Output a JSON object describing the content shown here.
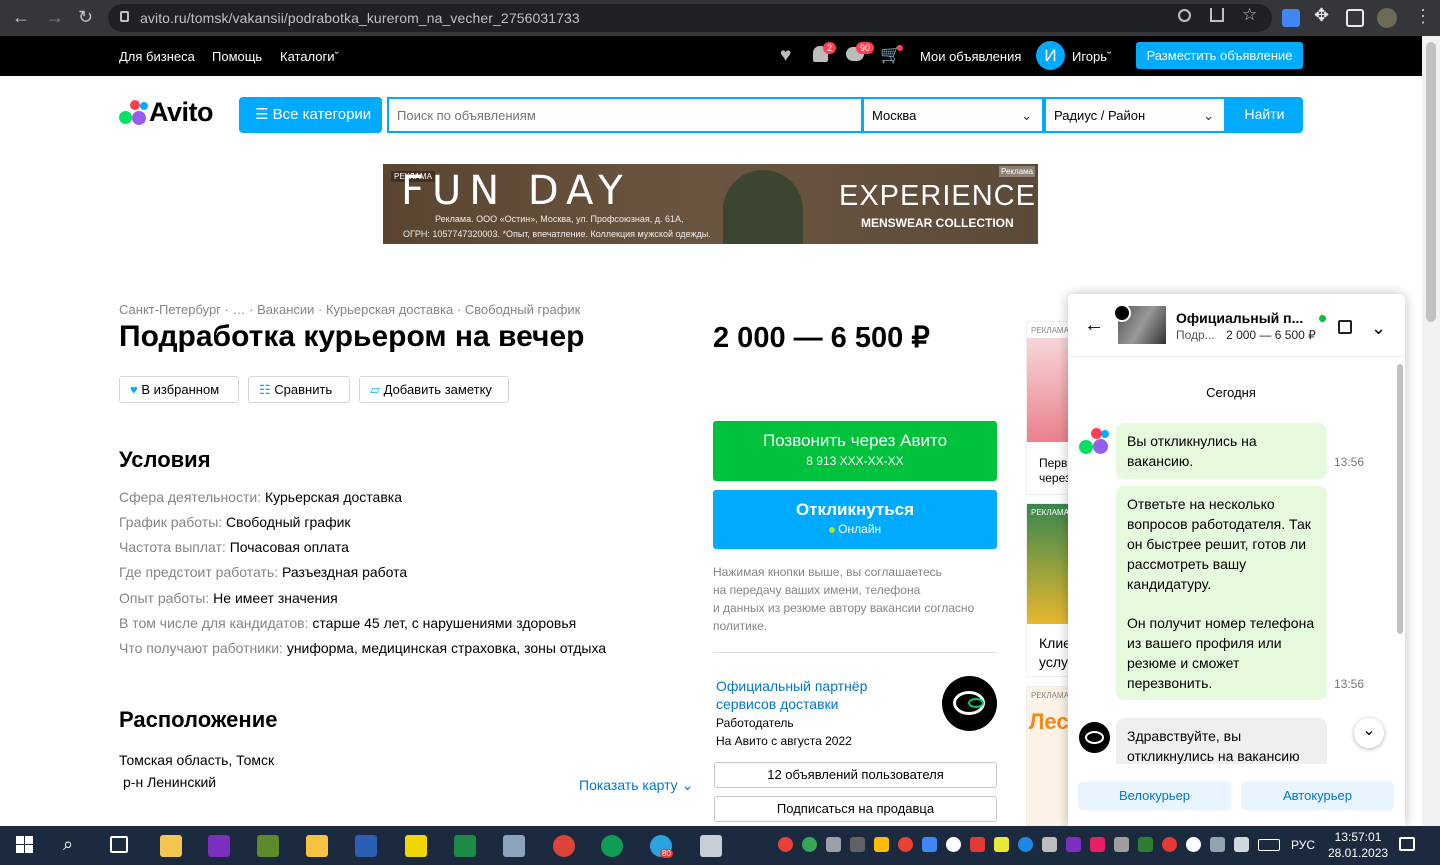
{
  "browser": {
    "url": "avito.ru/tomsk/vakansii/podrabotka_kurerom_na_vecher_2756031733",
    "back": "←",
    "forward": "→",
    "reload": "↻",
    "menu": "⋮"
  },
  "topbar": {
    "business": "Для бизнеса",
    "help": "Помощь",
    "catalogs": "Каталоги",
    "notif_count": "2",
    "msg_count": "90",
    "my_ads": "Мои объявления",
    "avatar_letter": "И",
    "user_name": "Игорь",
    "post_ad": "Разместить объявление"
  },
  "header": {
    "logo": "Avito",
    "all_categories": "Все категории",
    "search_placeholder": "Поиск по объявлениям",
    "city": "Москва",
    "radius": "Радиус / Район",
    "find": "Найти"
  },
  "banner": {
    "tag": "РЕКЛАМА",
    "brand": "FUN DAY",
    "legal1": "Реклама. ООО «Остин», Москва, ул. Профсоюзная, д. 61А,",
    "legal2": "ОГРН: 1057747320003. *Опыт, впечатление. Коллекция мужской одежды.",
    "experience": "EXPERIENCE",
    "collection": "MENSWEAR COLLECTION",
    "ad_label": "Реклама"
  },
  "breadcrumb": [
    "Санкт-Петербург",
    "…",
    "Вакансии",
    "Курьерская доставка",
    "Свободный график"
  ],
  "listing": {
    "title": "Подработка курьером на вечер",
    "price": "2 000 — 6 500 ₽",
    "favorite": "В избранном",
    "compare": "Сравнить",
    "add_note": "Добавить заметку"
  },
  "conditions": {
    "heading": "Условия",
    "rows": [
      {
        "label": "Сфера деятельности:",
        "value": "Курьерская доставка"
      },
      {
        "label": "График работы:",
        "value": "Свободный график"
      },
      {
        "label": "Частота выплат:",
        "value": "Почасовая оплата"
      },
      {
        "label": "Где предстоит работать:",
        "value": "Разъездная работа"
      },
      {
        "label": "Опыт работы:",
        "value": "Не имеет значения"
      },
      {
        "label": "В том числе для кандидатов:",
        "value": "старше 45 лет, с нарушениями здоровья"
      },
      {
        "label": "Что получают работники:",
        "value": "униформа, медицинская страховка, зоны отдыха"
      }
    ]
  },
  "location": {
    "heading": "Расположение",
    "address": "Томская область, Томск",
    "district": "р-н Ленинский",
    "show_map": "Показать карту"
  },
  "actions": {
    "call": "Позвонить через Авито",
    "phone": "8 913 XXX-XX-XX",
    "reply": "Откликнуться",
    "online": "Онлайн",
    "disclaimer": [
      "Нажимая кнопки выше, вы соглашаетесь",
      "на передачу ваших имени, телефона",
      "и данных из резюме автору вакансии согласно",
      "политике."
    ]
  },
  "seller": {
    "name_line1": "Официальный партнёр",
    "name_line2": "сервисов доставки",
    "role": "Работодатель",
    "since": "На Авито с августа 2022",
    "ads_count": "12 объявлений пользователя",
    "subscribe": "Подписаться на продавца"
  },
  "side_ads": {
    "label": "РЕКЛАМА",
    "ad1_text": "Перв через",
    "ad2_text": "Клие услу",
    "ad3_text": "Лес"
  },
  "chat": {
    "title": "Официальный п...",
    "subtitle": "Подр...",
    "price": "2 000 — 6 500 ₽",
    "date": "Сегодня",
    "msg1": "Вы откликнулись на вакансию.",
    "msg1_time": "13:56",
    "msg2_p1": "Ответьте на несколько вопросов работодателя. Так он быстрее решит, готов ли рассмотреть вашу кандидатуру.",
    "msg2_p2": "Он получит номер телефона из вашего профиля или резюме и сможет перезвонить.",
    "msg2_time": "13:56",
    "msg3": "Здравствуйте, вы откликнулись на вакансию",
    "chip1": "Велокурьер",
    "chip2": "Автокурьер"
  },
  "taskbar": {
    "lang": "РУС",
    "time": "13:57:01",
    "date": "28.01.2023",
    "telegram_badge": "80"
  },
  "colors": {
    "accent": "#00aaff",
    "green": "#00c13c",
    "chat_bubble": "#e5f9dd",
    "link": "#0077cc"
  }
}
